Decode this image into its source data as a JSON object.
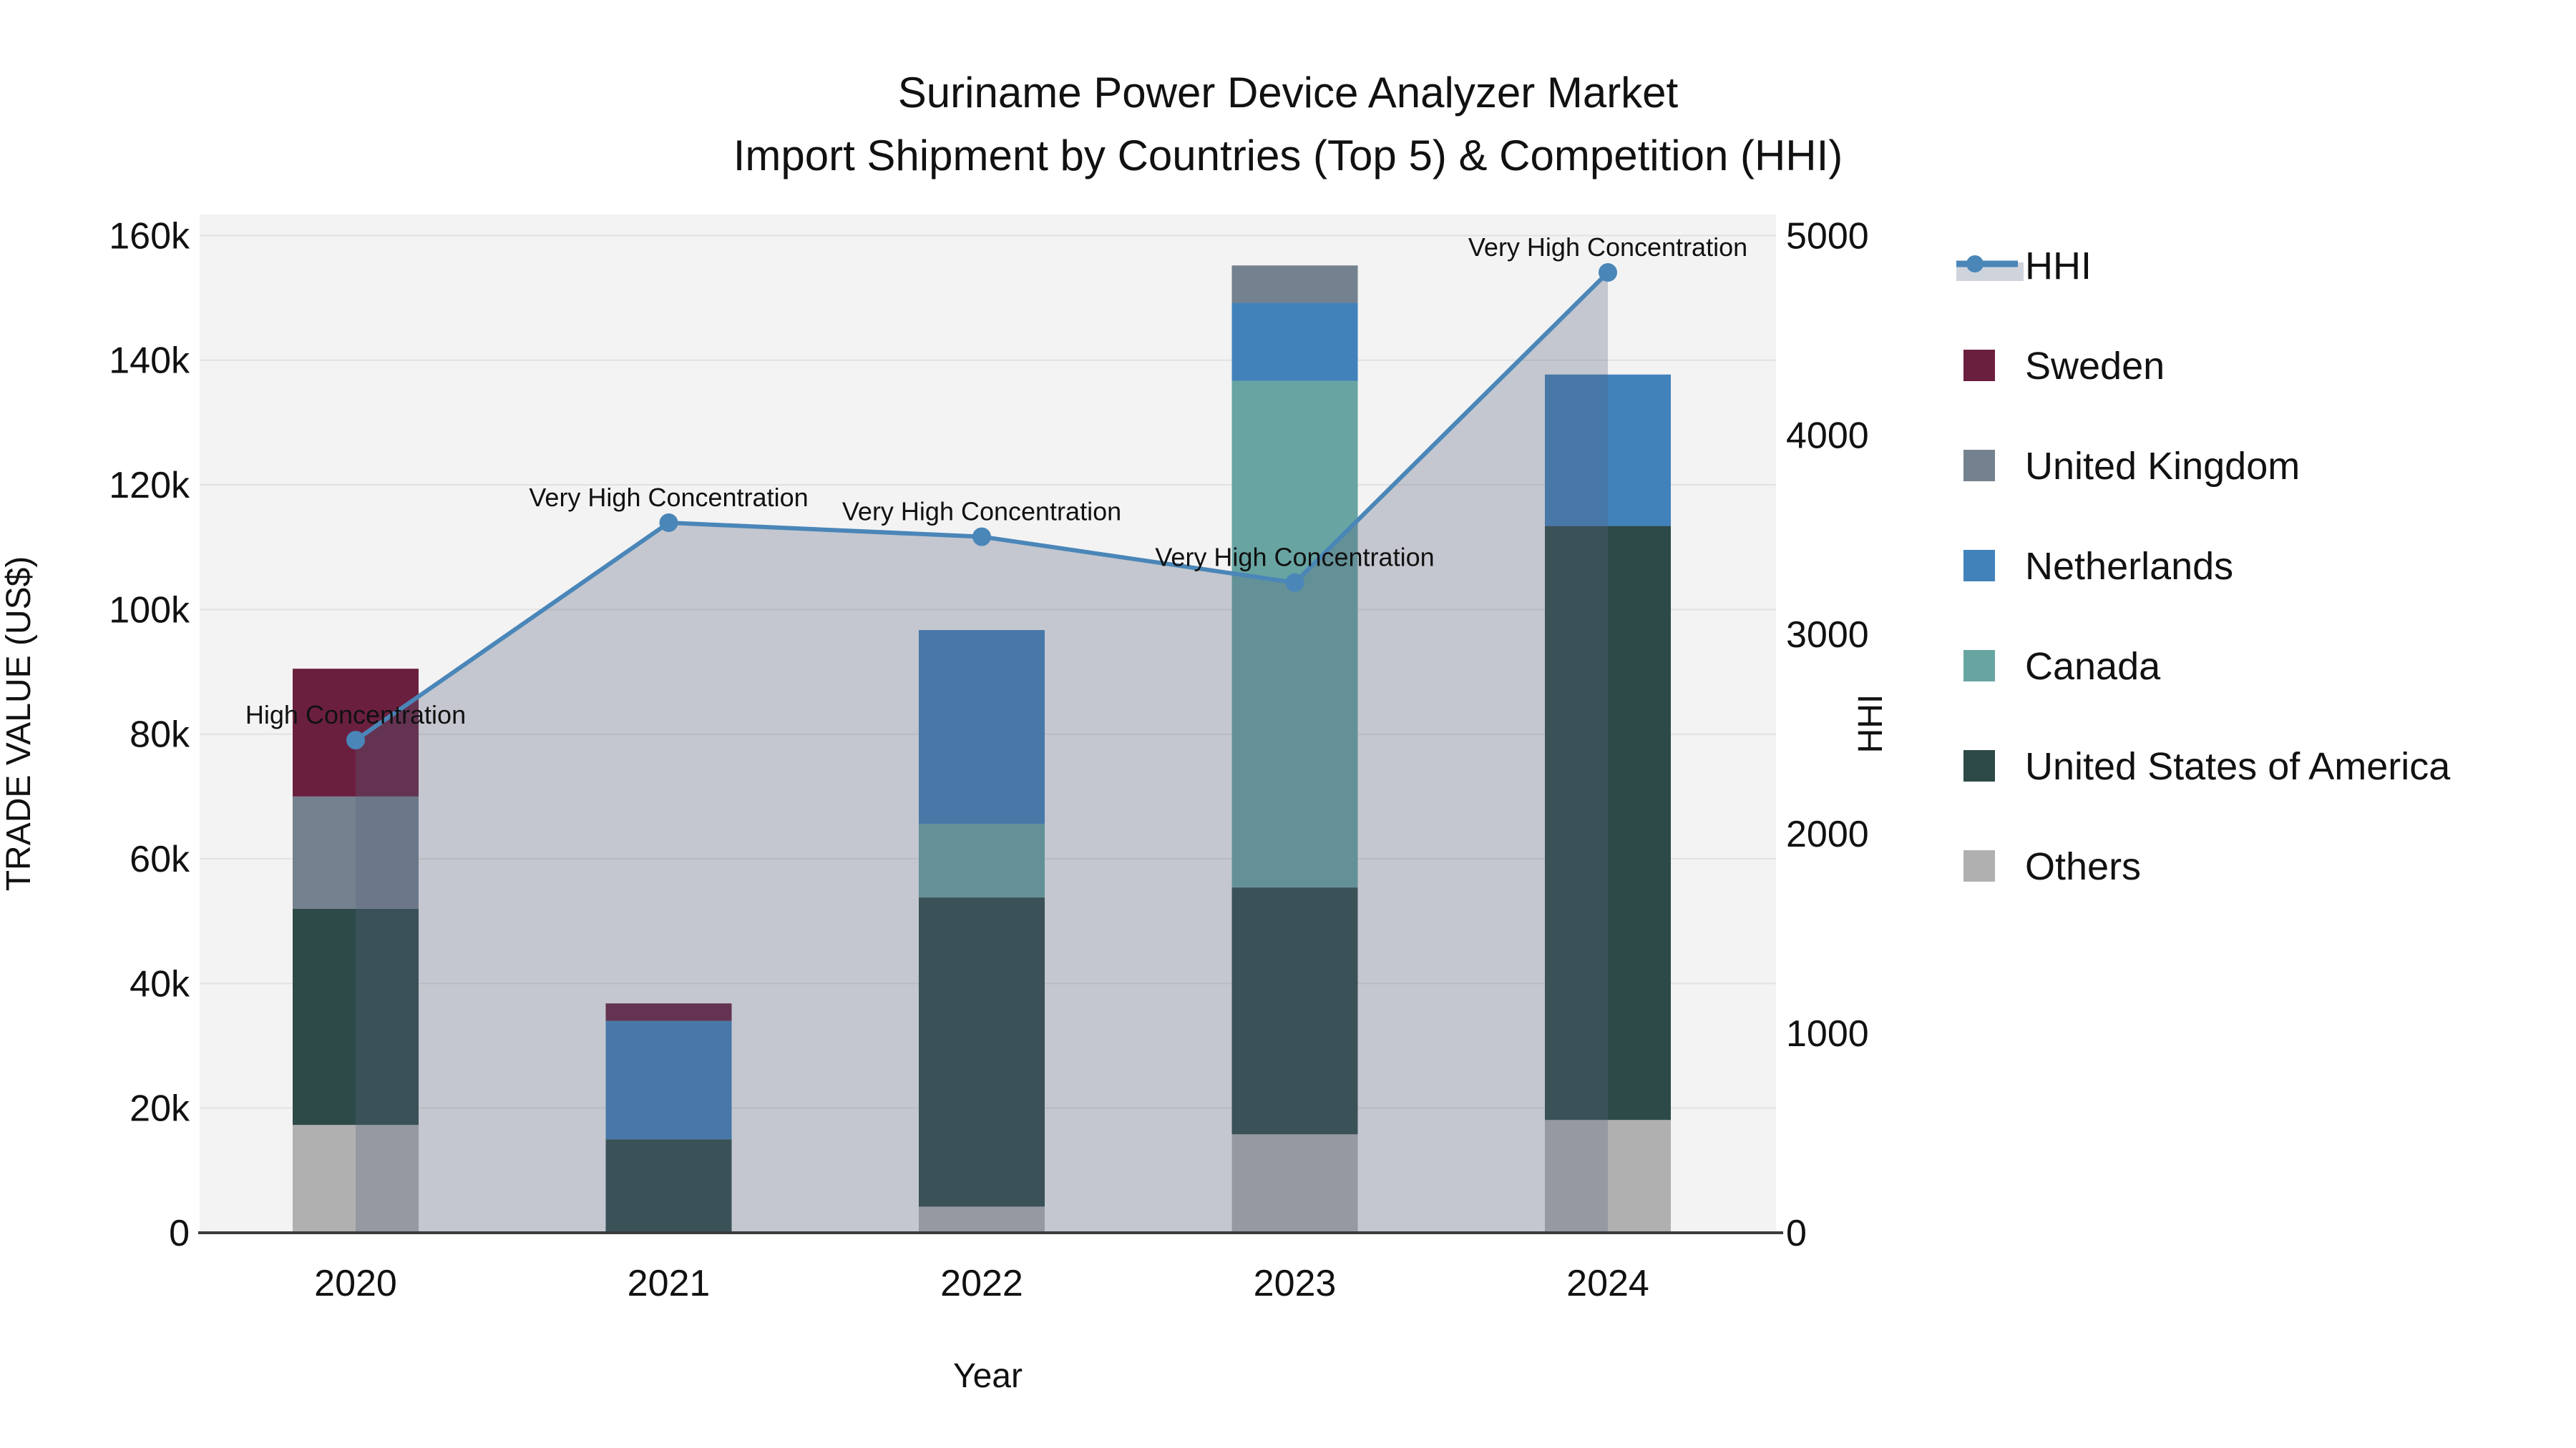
{
  "title": {
    "line1": "Suriname Power Device Analyzer Market",
    "line2": "Import Shipment by Countries (Top 5) & Competition (HHI)"
  },
  "x_axis": {
    "label": "Year",
    "tick_labels": [
      "2020",
      "2021",
      "2022",
      "2023",
      "2024"
    ]
  },
  "y_left": {
    "label": "TRADE VALUE (US$)",
    "tick_labels": [
      "0",
      "20k",
      "40k",
      "60k",
      "80k",
      "100k",
      "120k",
      "140k",
      "160k"
    ],
    "min": 0,
    "max": 160000
  },
  "y_right": {
    "label": "HHI",
    "tick_labels": [
      "0",
      "1000",
      "2000",
      "3000",
      "4000",
      "5000"
    ],
    "min": 0,
    "max": 5000
  },
  "legend": [
    {
      "id": "hhi",
      "label": "HHI",
      "type": "line",
      "color": "#4a86b8",
      "patch_color": "#cfd4dc"
    },
    {
      "id": "sweden",
      "label": "Sweden",
      "type": "box",
      "color": "#6b1f3f"
    },
    {
      "id": "united-kingdom",
      "label": "United Kingdom",
      "type": "box",
      "color": "#74818e"
    },
    {
      "id": "netherlands",
      "label": "Netherlands",
      "type": "box",
      "color": "#4182bb"
    },
    {
      "id": "canada",
      "label": "Canada",
      "type": "box",
      "color": "#68a5a2"
    },
    {
      "id": "united-states",
      "label": "United States of America",
      "type": "box",
      "color": "#2d4a48"
    },
    {
      "id": "others",
      "label": "Others",
      "type": "box",
      "color": "#b0b0b0"
    }
  ],
  "colors": {
    "plot_background": "#f3f3f3",
    "grid": "#e1e1e1",
    "axis_line": "#3b3b3b",
    "hhi_line": "#4a86b8",
    "hhi_area": "rgba(90,100,125,0.30)",
    "text": "#111111"
  },
  "chart_data": {
    "type": "stacked-bar+line",
    "title": "Suriname Power Device Analyzer Market — Import Shipment by Countries (Top 5) & Competition (HHI)",
    "categories": [
      "2020",
      "2021",
      "2022",
      "2023",
      "2024"
    ],
    "bar_unit": "US$ (trade value, left axis)",
    "series": [
      {
        "name": "Sweden",
        "color": "#6b1f3f",
        "values": [
          20500,
          2800,
          0,
          0,
          0
        ]
      },
      {
        "name": "United Kingdom",
        "color": "#74818e",
        "values": [
          18000,
          0,
          0,
          6000,
          0
        ]
      },
      {
        "name": "Netherlands",
        "color": "#4182bb",
        "values": [
          0,
          19000,
          31100,
          12500,
          24300
        ]
      },
      {
        "name": "Canada",
        "color": "#68a5a2",
        "values": [
          0,
          0,
          11800,
          81300,
          0
        ]
      },
      {
        "name": "United States of America",
        "color": "#2d4a48",
        "values": [
          34700,
          15000,
          49600,
          39600,
          95300
        ]
      },
      {
        "name": "Others",
        "color": "#b0b0b0",
        "values": [
          17300,
          0,
          4200,
          15800,
          18100
        ]
      }
    ],
    "bar_totals": [
      90500,
      36800,
      96700,
      155200,
      137700
    ],
    "stack_order_bottom_to_top": [
      "Others",
      "United States of America",
      "Canada",
      "Netherlands",
      "United Kingdom",
      "Sweden"
    ],
    "line_series": {
      "name": "HHI",
      "axis": "right",
      "color": "#4a86b8",
      "area_color": "rgba(90,100,125,0.30)",
      "values": [
        2470,
        3560,
        3490,
        3260,
        4815
      ],
      "annotations": [
        "High Concentration",
        "Very High Concentration",
        "Very High Concentration",
        "Very High Concentration",
        "Very High Concentration"
      ]
    },
    "ylim_left": [
      0,
      160000
    ],
    "ylim_right": [
      0,
      5000
    ],
    "grid": true,
    "legend_position": "right"
  }
}
